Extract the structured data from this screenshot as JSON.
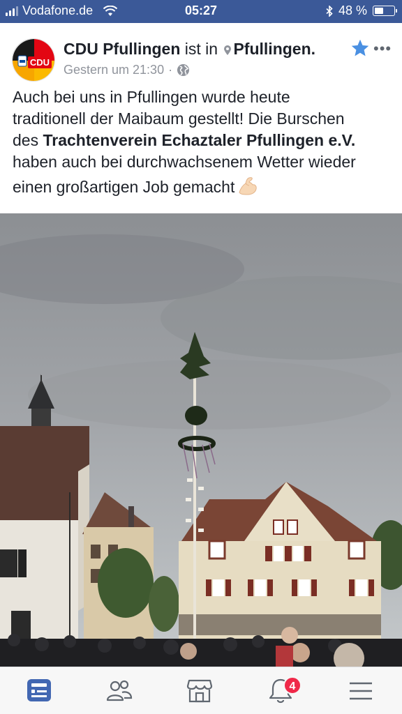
{
  "status_bar": {
    "carrier": "Vodafone.de",
    "time": "05:27",
    "battery_text": "48 %",
    "battery_level": 0.48
  },
  "post": {
    "page_name": "CDU Pfullingen",
    "is_in": "ist in",
    "location": "Pfullingen.",
    "timestamp": "Gestern um 21:30",
    "separator": "·",
    "avatar_logo_text": "CDU",
    "more_label": "•••",
    "text": {
      "line1": "Auch bei uns in Pfullingen wurde heute",
      "line2": "traditionell der Maibaum gestellt! Die Burschen",
      "line3_prefix": "des ",
      "line3_bold": "Trachtenverein Echaztaler Pfullingen e.V.",
      "line4": "haben auch bei durchwachsenem Wetter wieder",
      "line5": "einen großartigen Job gemacht"
    },
    "emoji": "flexed-biceps-icon"
  },
  "tab_bar": {
    "items": [
      "news-feed-icon",
      "friends-icon",
      "marketplace-icon",
      "notifications-icon",
      "menu-icon"
    ],
    "notifications_badge": "4",
    "accent": "#4267b2"
  },
  "colors": {
    "facebook_blue": "#3b5998",
    "text": "#1d2129",
    "meta": "#90949c",
    "badge": "#f02849"
  }
}
